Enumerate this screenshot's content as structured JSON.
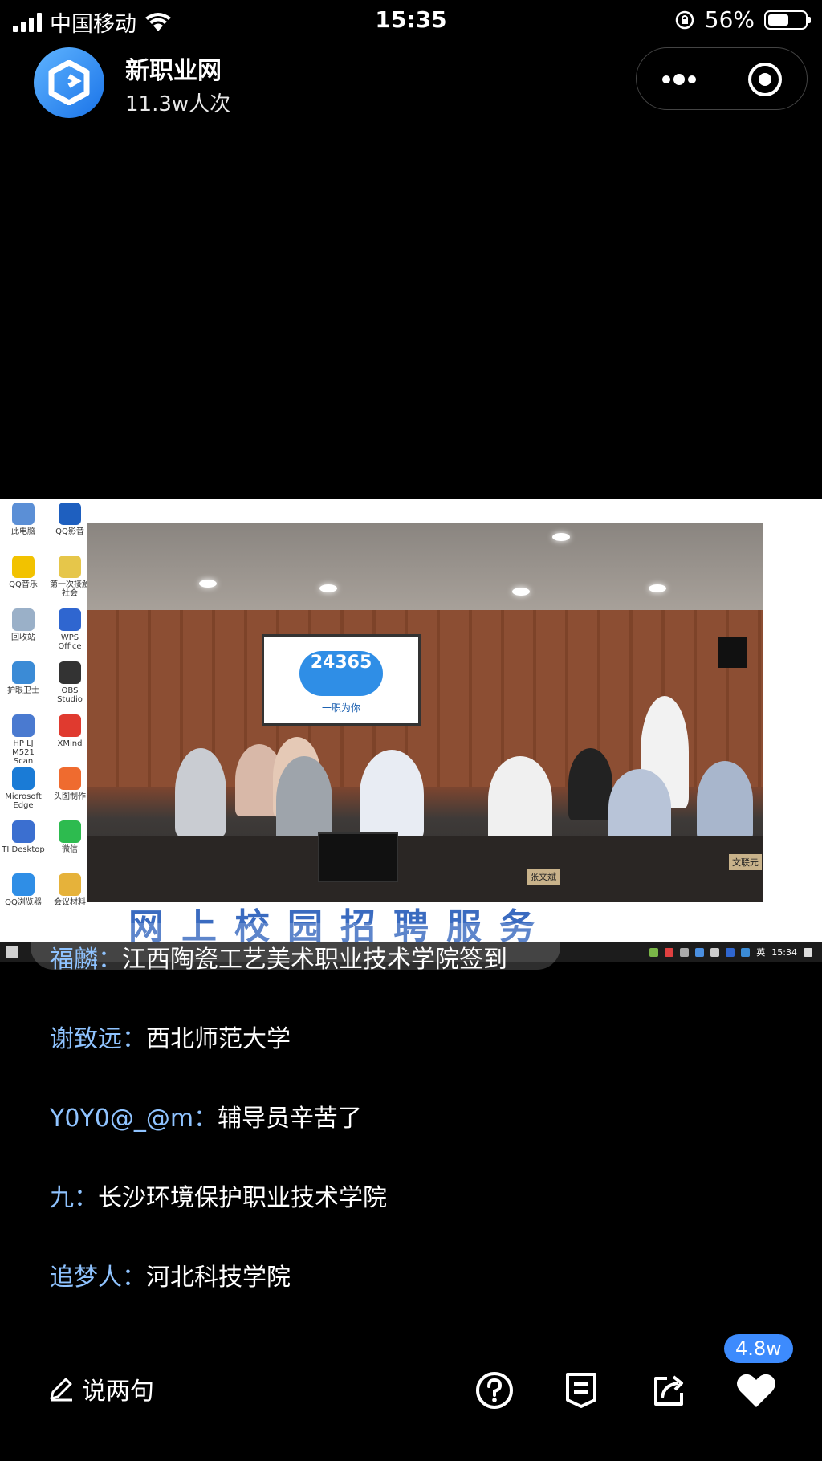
{
  "status_bar": {
    "carrier": "中国移动",
    "time": "15:35",
    "battery": "56%",
    "battery_level": 0.56
  },
  "header": {
    "title": "新职业网",
    "subtitle": "11.3w人次"
  },
  "stream": {
    "screen_logo": "24365",
    "screen_slogan": "一职为你",
    "banner": "网上校园招聘服务",
    "nameplate_center": "张文斌",
    "nameplate_right": "文联元",
    "taskbar_lang": "英",
    "taskbar_time": "15:34",
    "desktop_icons": [
      {
        "label": "此电脑",
        "color": "#5b8fd6"
      },
      {
        "label": "QQ影音",
        "color": "#1e5fbf"
      },
      {
        "label": "QQ音乐",
        "color": "#f2c200"
      },
      {
        "label": "第一次接触社会",
        "color": "#e6c64a"
      },
      {
        "label": "回收站",
        "color": "#9ab0c8"
      },
      {
        "label": "WPS Office",
        "color": "#2f66d0"
      },
      {
        "label": "护眼卫士",
        "color": "#3b8bd6"
      },
      {
        "label": "OBS Studio",
        "color": "#333333"
      },
      {
        "label": "HP LJ M521 Scan",
        "color": "#4a7ad0"
      },
      {
        "label": "XMind",
        "color": "#e03a2f"
      },
      {
        "label": "Microsoft Edge",
        "color": "#1a7bd6"
      },
      {
        "label": "头图制作",
        "color": "#ef6b2f"
      },
      {
        "label": "TI Desktop",
        "color": "#3b6fd0"
      },
      {
        "label": "微信",
        "color": "#2dbb4f"
      },
      {
        "label": "QQ浏览器",
        "color": "#2f8ee6"
      },
      {
        "label": "会议材料",
        "color": "#e6b23a"
      }
    ]
  },
  "comments": [
    {
      "user": "福麟：",
      "msg": "江西陶瓷工艺美术职业技术学院签到"
    },
    {
      "user": "谢致远：",
      "msg": "西北师范大学"
    },
    {
      "user": "Y0Y0@_@m：",
      "msg": "辅导员辛苦了"
    },
    {
      "user": "九：",
      "msg": "长沙环境保护职业技术学院"
    },
    {
      "user": "追梦人：",
      "msg": "河北科技学院"
    }
  ],
  "bottom_bar": {
    "say_label": "说两句",
    "like_count": "4.8w"
  },
  "colors": {
    "accent": "#3d8bfd",
    "comment_user": "#8fc3ff",
    "background": "#000000"
  }
}
